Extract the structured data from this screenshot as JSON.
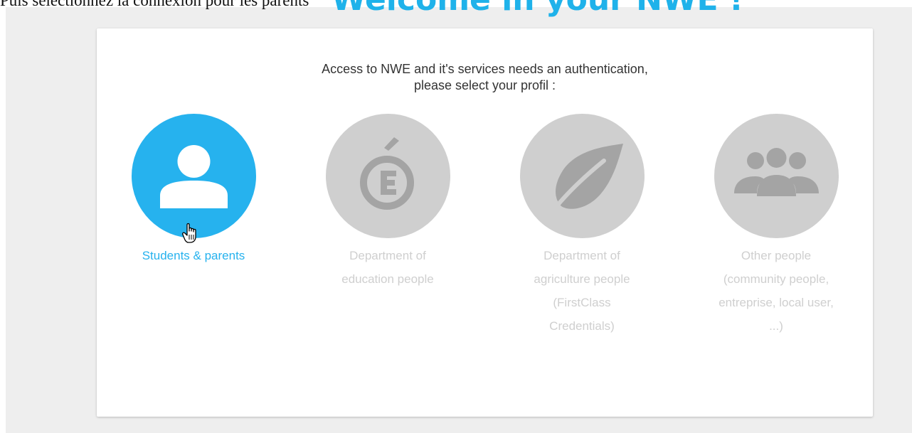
{
  "caption": "Puis sélectionnez la connexion pour les parents",
  "page": {
    "title": "Welcome in your NWE !"
  },
  "intro": {
    "line1": "Access to NWE and it's services needs an authentication,",
    "line2": "please select your profil :"
  },
  "profiles": [
    {
      "icon": "person-icon",
      "label_lines": [
        "Students & parents"
      ],
      "state": "selected"
    },
    {
      "icon": "education-logo-icon",
      "label_lines": [
        "Department of",
        "education people"
      ],
      "state": "default"
    },
    {
      "icon": "leaf-icon",
      "label_lines": [
        "Department of",
        "agriculture people",
        "(FirstClass",
        "Credentials)"
      ],
      "state": "default"
    },
    {
      "icon": "group-icon",
      "label_lines": [
        "Other people",
        "(community people,",
        "entreprise, local user,",
        "...)"
      ],
      "state": "default"
    }
  ],
  "colors": {
    "accent": "#26b2ee",
    "inactive": "#cfcfcf",
    "background": "#eeeeee",
    "card": "#ffffff"
  },
  "cursor": "hand-pointer-icon"
}
